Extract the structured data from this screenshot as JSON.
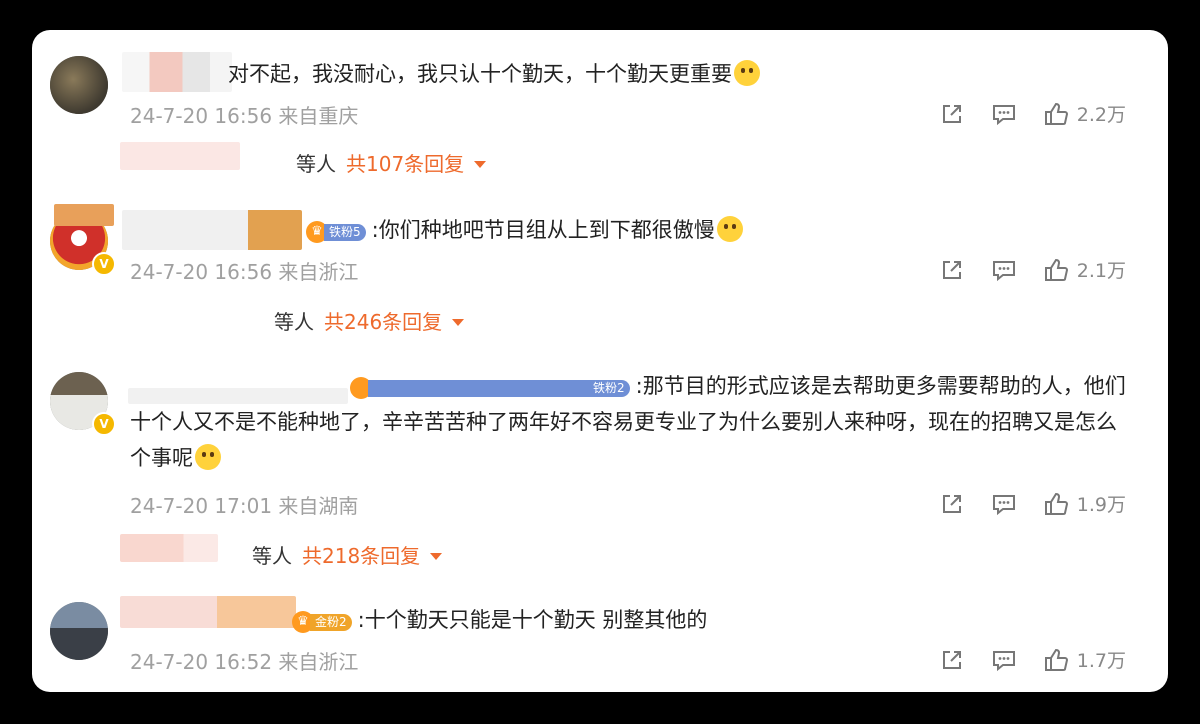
{
  "comments": [
    {
      "text_visible": "对不起，我没耐心，我只认十个勤天，十个勤天更重要",
      "time": "24-7-20 16:56",
      "location": "来自重庆",
      "likes": "2.2万",
      "replies_prefix": "等人",
      "replies_count": "共107条回复",
      "fan_badge": ""
    },
    {
      "text_visible": ":你们种地吧节目组从上到下都很傲慢",
      "time": "24-7-20 16:56",
      "location": "来自浙江",
      "likes": "2.1万",
      "replies_prefix": "等人",
      "replies_count": "共246条回复",
      "fan_badge": "铁粉5"
    },
    {
      "text_visible": ":那节目的形式应该是去帮助更多需要帮助的人，他们十个人又不是不能种地了，辛辛苦苦种了两年好不容易更专业了为什么要别人来种呀，现在的招聘又是怎么个事呢",
      "time": "24-7-20 17:01",
      "location": "来自湖南",
      "likes": "1.9万",
      "replies_prefix": "等人",
      "replies_count": "共218条回复",
      "fan_badge": "铁粉2"
    },
    {
      "text_visible": ":十个勤天只能是十个勤天 别整其他的",
      "time": "24-7-20 16:52",
      "location": "来自浙江",
      "likes": "1.7万",
      "replies_prefix": "",
      "replies_count": "",
      "fan_badge": "金粉2"
    }
  ],
  "colors": {
    "reply_accent": "#ee6a2c",
    "meta_gray": "#a0a0a0",
    "badge_iron": "#6f8fd6",
    "badge_gold": "#f0a429"
  },
  "icons": [
    "share-icon",
    "comment-icon",
    "like-icon",
    "verified-icon",
    "fan-crown-icon",
    "emoji"
  ]
}
